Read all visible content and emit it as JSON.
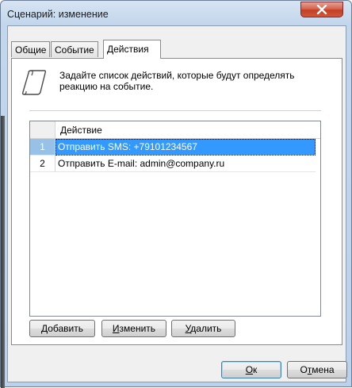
{
  "window": {
    "title": "Сценарий: изменение"
  },
  "tabs": [
    {
      "label": "Общие",
      "active": false
    },
    {
      "label": "Событие",
      "active": false
    },
    {
      "label": "Действия",
      "active": true
    }
  ],
  "info": {
    "text": "Задайте список действий, которые будут определять реакцию на событие."
  },
  "grid": {
    "column_header": "Действие",
    "rows": [
      {
        "num": "1",
        "action": "Отправить SMS: +79101234567",
        "selected": true
      },
      {
        "num": "2",
        "action": "Отправить E-mail: admin@company.ru",
        "selected": false
      }
    ]
  },
  "buttons": {
    "add": {
      "mnemonic": "Д",
      "rest": "обавить"
    },
    "edit": {
      "mnemonic": "И",
      "rest": "зменить"
    },
    "delete": {
      "mnemonic": "У",
      "rest": "далить"
    },
    "ok": {
      "mnemonic": "О",
      "rest": "к"
    },
    "cancel": {
      "pre": "О",
      "mnemonic": "т",
      "rest": "мена"
    }
  },
  "colors": {
    "selection": "#3399ff",
    "close_button": "#c33f24"
  }
}
